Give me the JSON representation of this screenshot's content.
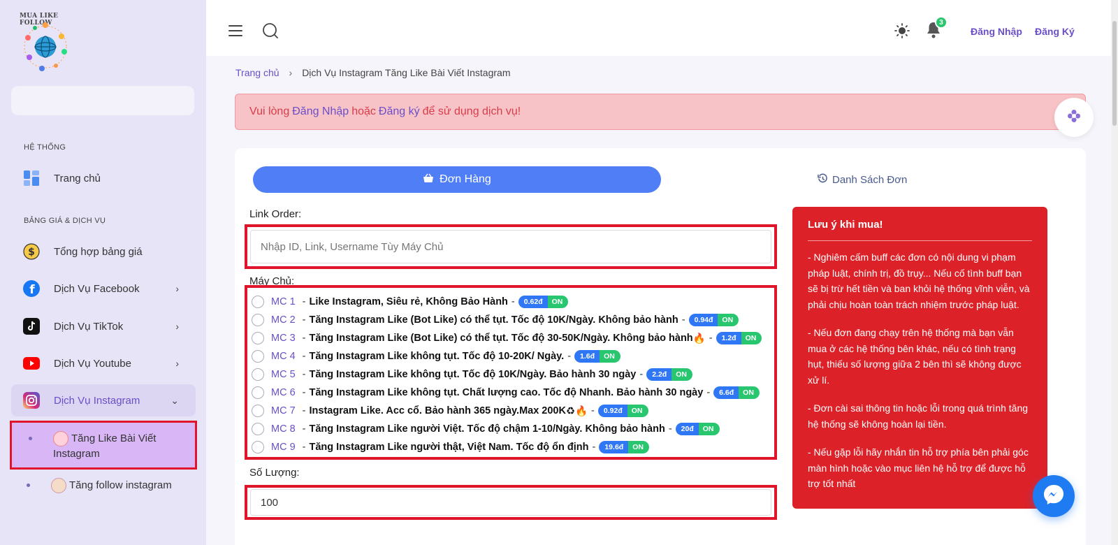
{
  "sidebar": {
    "logo_text": "MUA LIKE FOLLOW",
    "section_system": "HỆ THỐNG",
    "section_pricing": "BẢNG GIÁ & DỊCH VỤ",
    "items": [
      {
        "label": "Trang chủ"
      },
      {
        "label": "Tổng hợp bảng giá"
      },
      {
        "label": "Dịch Vụ Facebook"
      },
      {
        "label": "Dịch Vụ TikTok"
      },
      {
        "label": "Dịch Vụ Youtube"
      },
      {
        "label": "Dịch Vụ Instagram"
      }
    ],
    "sub_items": [
      {
        "label": "Tăng Like Bài Viết Instagram"
      },
      {
        "label": "Tăng follow instagram"
      }
    ]
  },
  "header": {
    "notification_count": "3",
    "login": "Đăng Nhập",
    "register": "Đăng Ký"
  },
  "breadcrumb": {
    "home": "Trang chủ",
    "current": "Dịch Vụ Instagram Tăng Like Bài Viết Instagram"
  },
  "alert": {
    "prefix": "Vui lòng",
    "login": "Đăng Nhập",
    "or": "hoặc",
    "register": "Đăng ký",
    "suffix": "để sử dụng dịch vụ!"
  },
  "tabs": {
    "order": "Đơn Hàng",
    "list": "Danh Sách Đơn"
  },
  "form": {
    "link_label": "Link Order:",
    "link_placeholder": "Nhập ID, Link, Username Tùy Máy Chủ",
    "server_label": "Máy Chủ:",
    "quantity_label": "Số Lượng:",
    "quantity_value": "100",
    "servers": [
      {
        "code": "MC 1",
        "name": "Like Instagram, Siêu rẻ, Không Bảo Hành",
        "emoji": "",
        "price": "0.62đ",
        "status": "ON"
      },
      {
        "code": "MC 2",
        "name": "Tăng Instagram Like (Bot Like) có thể tụt. Tốc độ 10K/Ngày. Không bảo hành",
        "emoji": "",
        "price": "0.94đ",
        "status": "ON"
      },
      {
        "code": "MC 3",
        "name": "Tăng Instagram Like (Bot Like) có thể tụt. Tốc độ 30-50K/Ngày. Không bảo hành",
        "emoji": "🔥",
        "price": "1.2đ",
        "status": "ON"
      },
      {
        "code": "MC 4",
        "name": "Tăng Instagram Like không tụt. Tốc độ 10-20K/ Ngày.",
        "emoji": "",
        "price": "1.6đ",
        "status": "ON"
      },
      {
        "code": "MC 5",
        "name": "Tăng Instagram Like không tụt. Tốc độ 10K/Ngày. Bảo hành 30 ngày",
        "emoji": "",
        "price": "2.2đ",
        "status": "ON"
      },
      {
        "code": "MC 6",
        "name": "Tăng Instagram Like không tụt. Chất lượng cao. Tốc độ Nhanh. Bảo hành 30 ngày",
        "emoji": "",
        "price": "6.6đ",
        "status": "ON"
      },
      {
        "code": "MC 7",
        "name": "Instagram Like. Acc cổ. Bảo hành 365 ngày.Max 200K",
        "emoji": "♻🔥",
        "price": "0.92đ",
        "status": "ON"
      },
      {
        "code": "MC 8",
        "name": "Tăng Instagram Like người Việt. Tốc độ chậm 1-10/Ngày. Không bảo hành",
        "emoji": "",
        "price": "20đ",
        "status": "ON"
      },
      {
        "code": "MC 9",
        "name": "Tăng Instagram Like người thật, Việt Nam. Tốc độ ổn định",
        "emoji": "",
        "price": "19.6đ",
        "status": "ON"
      }
    ]
  },
  "note": {
    "title": "Lưu ý khi mua!",
    "paragraphs": [
      "- Nghiêm cấm buff các đơn có nội dung vi phạm pháp luật, chính trị, đồ trụy... Nếu cố tình buff bạn sẽ bị trừ hết tiền và ban khỏi hệ thống vĩnh viễn, và phải chịu hoàn toàn trách nhiệm trước pháp luật.",
      "- Nếu đơn đang chạy trên hệ thống mà bạn vẫn mua ở các hệ thống bên khác, nếu có tình trạng hụt, thiếu số lượng giữa 2 bên thì sẽ không được xử lí.",
      "- Đơn cài sai thông tin hoặc lỗi trong quá trình tăng hệ thống sẽ không hoàn lại tiền.",
      "- Nếu gặp lỗi hãy nhắn tin hỗ trợ phía bên phải góc màn hình hoặc vào mục liên hệ hỗ trợ để được hỗ trợ tốt nhất"
    ]
  },
  "colors": {
    "accent": "#6a4fc8",
    "primary_button": "#4f7ef6",
    "note_bg": "#dd2128",
    "alert_bg": "#f7c3c6",
    "highlight_border": "#e0142a"
  }
}
